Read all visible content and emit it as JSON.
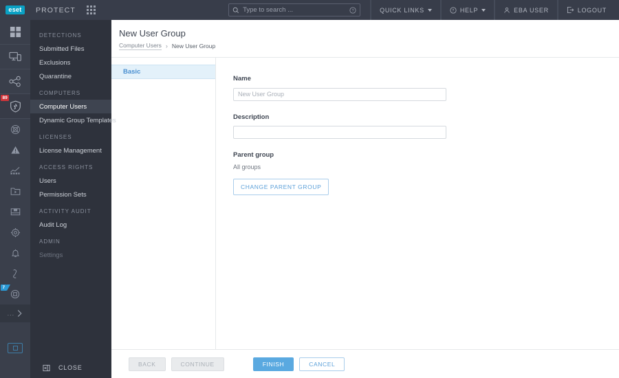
{
  "topbar": {
    "logo_text": "eset",
    "product": "PROTECT",
    "apps_icon": "apps-grid-icon",
    "search": {
      "placeholder": "Type to search ...",
      "value": "",
      "icon": "search-icon",
      "help_icon": "question-circle-icon"
    },
    "items": [
      {
        "label": "QUICK LINKS",
        "icon": "",
        "caret": true,
        "name": "quick-links"
      },
      {
        "label": "HELP",
        "icon": "question-circle-icon",
        "caret": true,
        "name": "help"
      },
      {
        "label": "EBA USER",
        "icon": "user-icon",
        "caret": false,
        "name": "eba-user"
      },
      {
        "label": "LOGOUT",
        "icon": "logout-icon",
        "caret": false,
        "name": "logout"
      }
    ]
  },
  "rail": {
    "items": [
      {
        "name": "dashboard-icon",
        "badge": ""
      },
      {
        "name": "computers-icon",
        "badge": ""
      },
      {
        "name": "network-share-icon",
        "badge": ""
      },
      {
        "name": "detections-shield-icon",
        "badge": "89"
      },
      {
        "name": "incidents-icon",
        "badge": ""
      },
      {
        "name": "alerts-warning-icon",
        "badge": ""
      },
      {
        "name": "reports-chart-icon",
        "badge": ""
      },
      {
        "name": "tasks-play-icon",
        "badge": ""
      },
      {
        "name": "installers-box-icon",
        "badge": ""
      },
      {
        "name": "policies-gear-icon",
        "badge": ""
      },
      {
        "name": "notifications-bell-icon",
        "badge": ""
      },
      {
        "name": "status-overview-icon",
        "badge": ""
      },
      {
        "name": "more-modules-icon",
        "badge": "7"
      }
    ],
    "more_label": "...",
    "monitor_icon": "remote-console-icon"
  },
  "nav": {
    "groups": [
      {
        "title": "DETECTIONS",
        "items": [
          {
            "label": "Submitted Files",
            "state": "normal"
          },
          {
            "label": "Exclusions",
            "state": "normal"
          },
          {
            "label": "Quarantine",
            "state": "normal"
          }
        ]
      },
      {
        "title": "COMPUTERS",
        "items": [
          {
            "label": "Computer Users",
            "state": "selected"
          },
          {
            "label": "Dynamic Group Templates",
            "state": "normal"
          }
        ]
      },
      {
        "title": "LICENSES",
        "items": [
          {
            "label": "License Management",
            "state": "normal"
          }
        ]
      },
      {
        "title": "ACCESS RIGHTS",
        "items": [
          {
            "label": "Users",
            "state": "normal"
          },
          {
            "label": "Permission Sets",
            "state": "normal"
          }
        ]
      },
      {
        "title": "ACTIVITY AUDIT",
        "items": [
          {
            "label": "Audit Log",
            "state": "normal"
          }
        ]
      },
      {
        "title": "ADMIN",
        "items": [
          {
            "label": "Settings",
            "state": "disabled"
          }
        ]
      }
    ],
    "close_label": "CLOSE",
    "close_icon": "collapse-panel-icon"
  },
  "page": {
    "title": "New User Group",
    "breadcrumb": {
      "parent": "Computer Users",
      "separator": "›",
      "current": "New User Group"
    },
    "steps": [
      {
        "label": "Basic",
        "active": true
      }
    ]
  },
  "form": {
    "name": {
      "label": "Name",
      "value": "",
      "placeholder": "New User Group"
    },
    "description": {
      "label": "Description",
      "value": "",
      "placeholder": ""
    },
    "parent_group": {
      "label": "Parent group",
      "value": "All groups",
      "button_label": "CHANGE PARENT GROUP"
    }
  },
  "footer": {
    "back": "BACK",
    "continue": "CONTINUE",
    "finish": "FINISH",
    "cancel": "CANCEL"
  },
  "colors": {
    "topbar_bg": "#383d4a",
    "rail_bg": "#3a3f4b",
    "nav_bg": "#2e323c",
    "brand_cyan": "#0aa1c4",
    "accent_blue": "#5aa9e0",
    "badge_red": "#d0343a",
    "badge_blue": "#2b9ad6"
  }
}
